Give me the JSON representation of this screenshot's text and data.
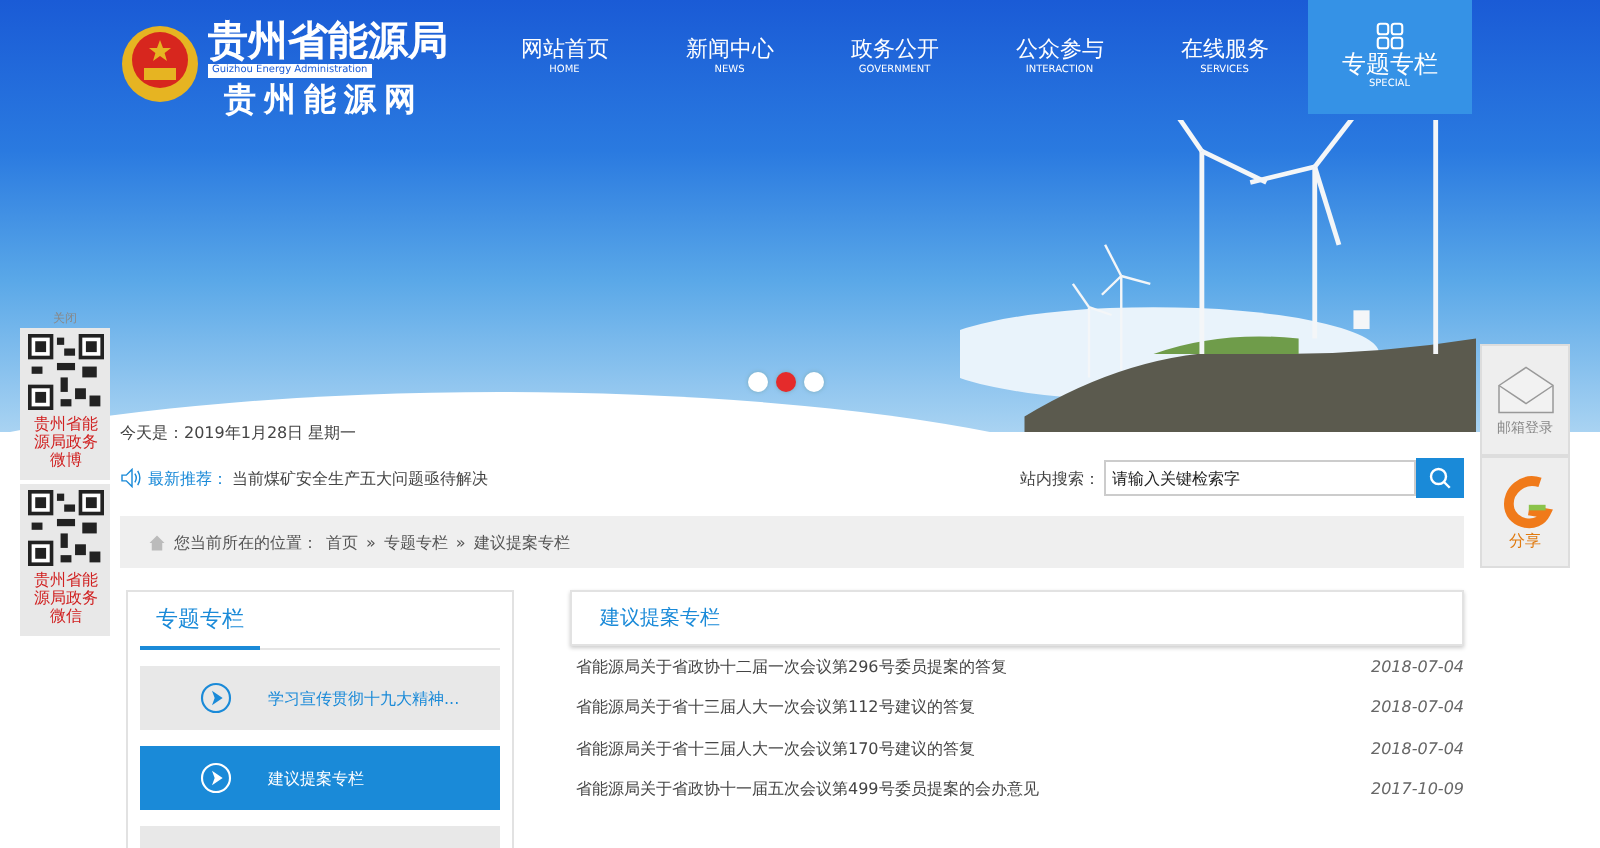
{
  "header": {
    "logo_title": "贵州省能源局",
    "logo_subtitle_en": "Guizhou Energy Administration",
    "logo_subtitle": "贵州能源网"
  },
  "nav": [
    {
      "label": "网站首页",
      "label_en": "HOME",
      "selected": false
    },
    {
      "label": "新闻中心",
      "label_en": "NEWS",
      "selected": false
    },
    {
      "label": "政务公开",
      "label_en": "GOVERNMENT",
      "selected": false
    },
    {
      "label": "公众参与",
      "label_en": "INTERACTION",
      "selected": false
    },
    {
      "label": "在线服务",
      "label_en": "SERVICES",
      "selected": false
    },
    {
      "label": "专题专栏",
      "label_en": "SPECIAL",
      "selected": true
    }
  ],
  "carousel_dots": [
    {
      "selected": false
    },
    {
      "selected": true
    },
    {
      "selected": false
    }
  ],
  "left_float": {
    "close": "关闭",
    "codes": [
      {
        "caption": "贵州省能源局政务微博"
      },
      {
        "caption": "贵州省能源局政务微信"
      }
    ]
  },
  "right_float": [
    {
      "kind": "mail",
      "label": "邮箱登录"
    },
    {
      "kind": "share",
      "label": "分享"
    }
  ],
  "date_line": "今天是：2019年1月28日 星期一",
  "latest": {
    "label": "最新推荐：",
    "text": "当前煤矿安全生产五大问题亟待解决"
  },
  "search": {
    "label": "站内搜索：",
    "placeholder": "请输入关键检索字"
  },
  "breadcrumb": {
    "prefix": "您当前所在的位置：",
    "items": [
      "首页",
      "专题专栏",
      "建议提案专栏"
    ],
    "separator": "»"
  },
  "side_menu": {
    "title": "专题专栏",
    "items": [
      {
        "label": "学习宣传贯彻十九大精神...",
        "selected": false
      },
      {
        "label": "建议提案专栏",
        "selected": true
      }
    ]
  },
  "list": {
    "title": "建议提案专栏",
    "rows": [
      {
        "title": "省能源局关于省政协十二届一次会议第296号委员提案的答复",
        "date": "2018-07-04"
      },
      {
        "title": "省能源局关于省十三届人大一次会议第112号建议的答复",
        "date": "2018-07-04"
      },
      {
        "title": "省能源局关于省十三届人大一次会议第170号建议的答复",
        "date": "2018-07-04"
      },
      {
        "title": "省能源局关于省政协十一届五次会议第499号委员提案的会办意见",
        "date": "2017-10-09"
      }
    ]
  }
}
